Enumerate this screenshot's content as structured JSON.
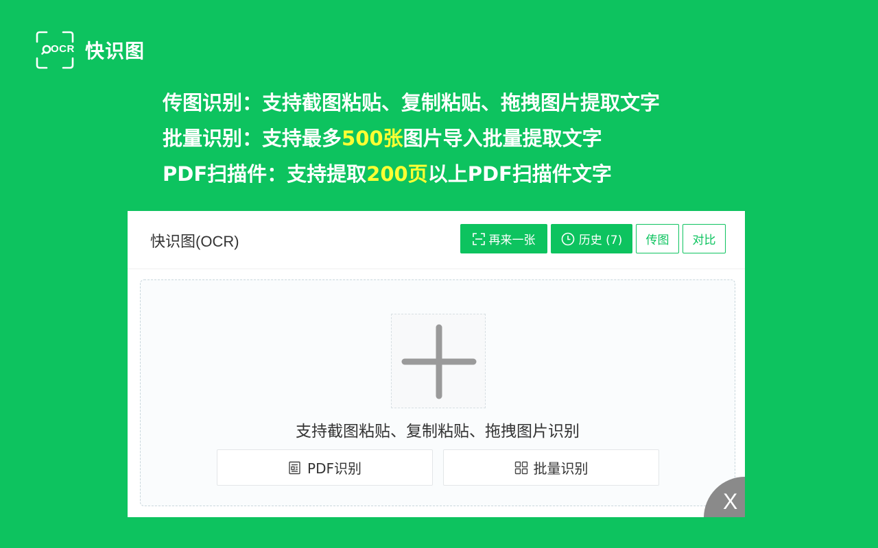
{
  "brand": {
    "logo_text": "OCR",
    "name": "快识图"
  },
  "features": [
    {
      "prefix": "传图识别：支持截图粘贴、复制粘贴、拖拽图片提取文字",
      "highlight": "",
      "suffix": ""
    },
    {
      "prefix": "批量识别：支持最多",
      "highlight": "500张",
      "suffix": "图片导入批量提取文字"
    },
    {
      "prefix": "PDF扫描件：支持提取",
      "highlight": "200页",
      "suffix": "以上PDF扫描件文字"
    }
  ],
  "card": {
    "title": "快识图(OCR)",
    "toolbar": {
      "again_label": "再来一张",
      "again_icon": "scan-icon",
      "history_label": "历史 (7)",
      "history_icon": "clock-icon",
      "upload_label": "传图",
      "compare_label": "对比"
    },
    "dropzone": {
      "add_icon": "plus-icon",
      "hint": "支持截图粘贴、复制粘贴、拖拽图片识别",
      "pdf_label": "PDF识别",
      "pdf_icon": "document-icon",
      "batch_label": "批量识别",
      "batch_icon": "grid-icon"
    },
    "close_label": "X"
  },
  "colors": {
    "brand_green": "#0dc35f",
    "highlight_yellow": "#ffff33",
    "close_gray": "#8a8a8a"
  }
}
